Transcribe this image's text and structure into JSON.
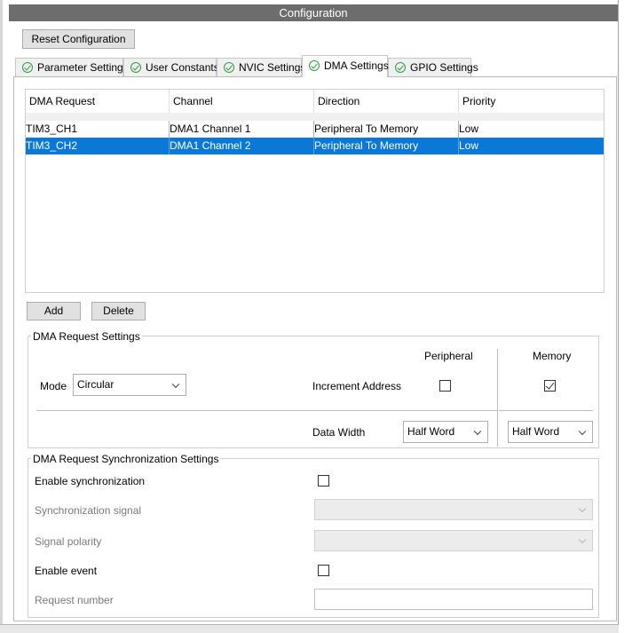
{
  "window": {
    "title": "Configuration"
  },
  "toolbar": {
    "reset_label": "Reset Configuration"
  },
  "tabs": [
    {
      "label": "Parameter Settings",
      "icon": "check-circle-icon"
    },
    {
      "label": "User Constants",
      "icon": "check-circle-icon"
    },
    {
      "label": "NVIC Settings",
      "icon": "check-circle-icon"
    },
    {
      "label": "DMA Settings",
      "icon": "check-circle-icon",
      "active": true
    },
    {
      "label": "GPIO Settings",
      "icon": "check-circle-icon"
    }
  ],
  "dma_table": {
    "columns": [
      "DMA Request",
      "Channel",
      "Direction",
      "Priority"
    ],
    "rows": [
      {
        "request": "TIM3_CH1",
        "channel": "DMA1 Channel 1",
        "direction": "Peripheral To Memory",
        "priority": "Low",
        "selected": false
      },
      {
        "request": "TIM3_CH2",
        "channel": "DMA1 Channel 2",
        "direction": "Peripheral To Memory",
        "priority": "Low",
        "selected": true
      }
    ],
    "selection_color": "#0a78d7"
  },
  "table_buttons": {
    "add_label": "Add",
    "delete_label": "Delete"
  },
  "request_settings": {
    "title": "DMA Request Settings",
    "mode_label": "Mode",
    "mode_value": "Circular",
    "peripheral_header": "Peripheral",
    "memory_header": "Memory",
    "increment_label": "Increment Address",
    "increment_peripheral": false,
    "increment_memory": true,
    "data_width_label": "Data Width",
    "data_width_peripheral": "Half Word",
    "data_width_memory": "Half Word"
  },
  "sync_settings": {
    "title": "DMA Request Synchronization Settings",
    "enable_sync_label": "Enable synchronization",
    "enable_sync": false,
    "sync_signal_label": "Synchronization signal",
    "sync_signal_value": "",
    "signal_polarity_label": "Signal polarity",
    "signal_polarity_value": "",
    "enable_event_label": "Enable event",
    "enable_event": false,
    "request_number_label": "Request number",
    "request_number_value": ""
  }
}
